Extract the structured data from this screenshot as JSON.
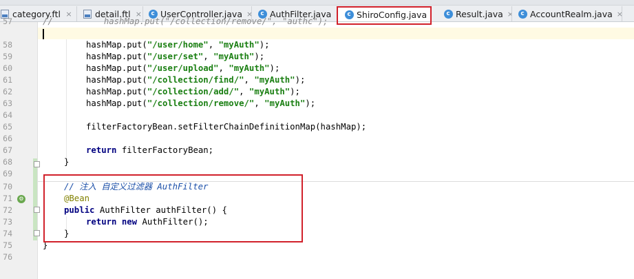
{
  "tabs": [
    {
      "label": "category.ftl",
      "type": "ftl",
      "close": "×"
    },
    {
      "label": "detail.ftl",
      "type": "ftl",
      "close": "×"
    },
    {
      "label": "UserController.java",
      "type": "class",
      "close": "×"
    },
    {
      "label": "AuthFilter.java",
      "type": "class",
      "close": "×"
    },
    {
      "label": "ShiroConfig.java",
      "type": "class",
      "close": "×",
      "active": true
    },
    {
      "label": "Result.java",
      "type": "class",
      "close": "×"
    },
    {
      "label": "AccountRealm.java",
      "type": "class",
      "close": "×"
    }
  ],
  "class_icon_letter": "c",
  "highlight_color": "#d1202a",
  "editor": {
    "lines": [
      {
        "n": "57",
        "code": "//          hashMap.put(\"/collection/remove/\", \"authc\");"
      },
      {
        "n": "58",
        "code": "hashMap.put(\"/user/home\", \"myAuth\");"
      },
      {
        "n": "59",
        "code": "hashMap.put(\"/user/set\", \"myAuth\");"
      },
      {
        "n": "60",
        "code": "hashMap.put(\"/user/upload\", \"myAuth\");"
      },
      {
        "n": "61",
        "code": "hashMap.put(\"/collection/find/\", \"myAuth\");"
      },
      {
        "n": "62",
        "code": "hashMap.put(\"/collection/add/\", \"myAuth\");"
      },
      {
        "n": "63",
        "code": "hashMap.put(\"/collection/remove/\", \"myAuth\");"
      },
      {
        "n": "64",
        "code": ""
      },
      {
        "n": "65",
        "code": "filterFactoryBean.setFilterChainDefinitionMap(hashMap);"
      },
      {
        "n": "66",
        "code": ""
      },
      {
        "n": "67",
        "code": "return filterFactoryBean;"
      },
      {
        "n": "68",
        "code": "}"
      },
      {
        "n": "69",
        "code": ""
      },
      {
        "n": "70",
        "code": "// 注入 自定义过滤器 AuthFilter"
      },
      {
        "n": "71",
        "code": "@Bean"
      },
      {
        "n": "72",
        "code": "public AuthFilter authFilter() {"
      },
      {
        "n": "73",
        "code": "return new AuthFilter();"
      },
      {
        "n": "74",
        "code": "}"
      },
      {
        "n": "75",
        "code": "}"
      },
      {
        "n": "76",
        "code": ""
      }
    ]
  },
  "gutter_icons": {
    "bean": "bean-icon"
  }
}
